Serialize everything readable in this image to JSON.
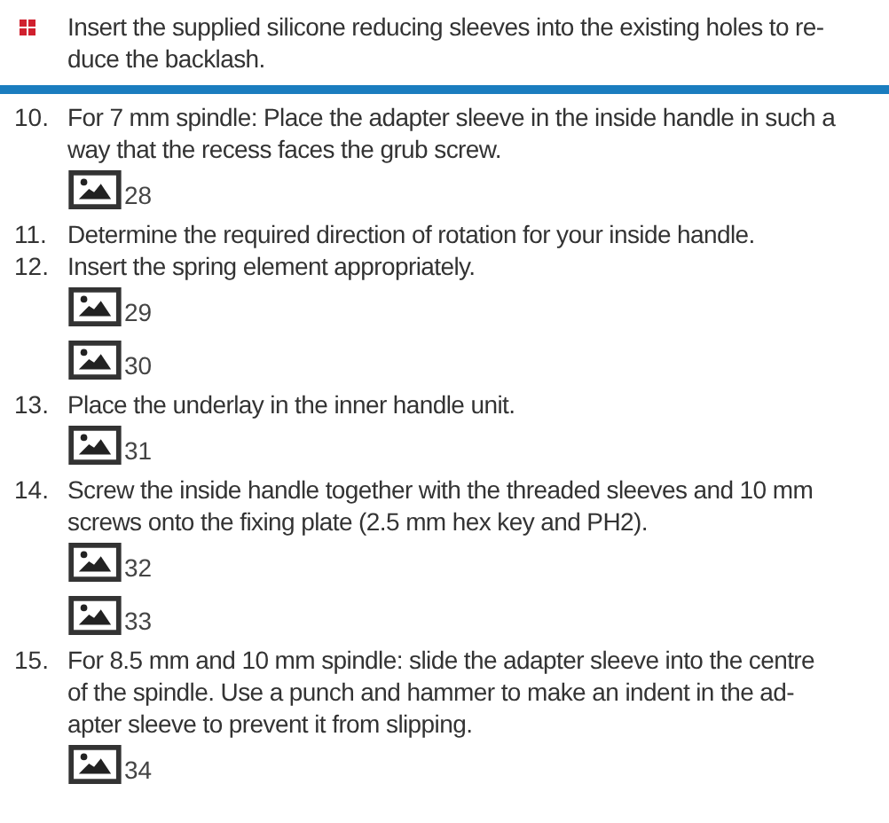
{
  "note": {
    "lines": [
      "Insert the supplied silicone reducing sleeves into the existing holes to re-",
      "duce the backlash."
    ]
  },
  "steps": [
    {
      "number": "10.",
      "lines": [
        "For 7 mm spindle: Place the adapter sleeve in the inside handle in such a",
        "way that the recess faces the grub screw."
      ],
      "figures": [
        "28"
      ]
    },
    {
      "number": "11.",
      "lines": [
        "Determine the required direction of rotation for your inside handle."
      ]
    },
    {
      "number": "12.",
      "lines": [
        "Insert the spring element appropriately."
      ],
      "figures": [
        "29",
        "30"
      ]
    },
    {
      "number": "13.",
      "lines": [
        "Place the underlay in the inner handle unit."
      ],
      "figures": [
        "31"
      ]
    },
    {
      "number": "14.",
      "lines": [
        "Screw the inside handle together with the threaded sleeves and 10 mm",
        "screws onto the fixing plate (2.5 mm hex key and PH2)."
      ],
      "figures": [
        "32",
        "33"
      ]
    },
    {
      "number": "15.",
      "lines": [
        "For 8.5 mm and 10 mm spindle: slide the adapter sleeve into the centre",
        "of the spindle. Use a punch and hammer to make an indent in the ad-",
        "apter sleeve to prevent it from slipping."
      ],
      "figures": [
        "34"
      ]
    }
  ]
}
